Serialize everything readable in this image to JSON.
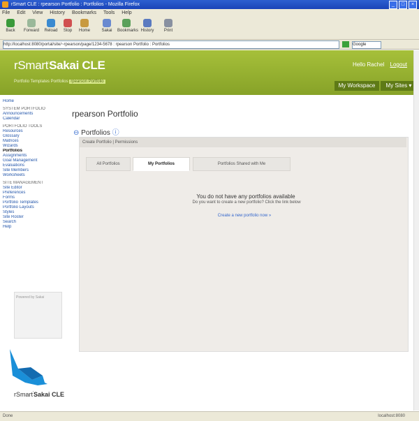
{
  "browser": {
    "title": "rSmart CLE : rpearson Portfolio : Portfolios - Mozilla Firefox",
    "menu": [
      "File",
      "Edit",
      "View",
      "History",
      "Bookmarks",
      "Tools",
      "Help"
    ],
    "toolbar": [
      "Back",
      "Forward",
      "Reload",
      "Stop",
      "Home",
      "Sakai",
      "Bookmarks",
      "History",
      "Print"
    ],
    "address": "http://localhost:8080/portal/site/~rpearson/page/1234-5678 : rpearson Portfolio : Portfolios",
    "search_placeholder": "Google",
    "status_left": "Done",
    "status_right": "localhost:8080"
  },
  "header": {
    "brand_prefix": "rSmart",
    "brand_main": "Sakai CLE",
    "greeting": "Hello Rachel",
    "logout": "Logout",
    "tabs_text": "Portfolio Templates Portfolios",
    "current_tab": "rpearson Portfolio",
    "my_workspace": "My Workspace",
    "my_sites": "My Sites ▾"
  },
  "leftnav": {
    "items": [
      {
        "label": "Home",
        "section": false,
        "current": false
      },
      {
        "label": "SYSTEM PORTFOLIO",
        "section": true,
        "current": false
      },
      {
        "label": "Announcements",
        "section": false,
        "current": false
      },
      {
        "label": "Calendar",
        "section": false,
        "current": false
      },
      {
        "label": "PORTFOLIO TOOLS",
        "section": true,
        "current": false
      },
      {
        "label": "Resources",
        "section": false,
        "current": false
      },
      {
        "label": "Glossary",
        "section": false,
        "current": false
      },
      {
        "label": "Matrices",
        "section": false,
        "current": false
      },
      {
        "label": "Wizards",
        "section": false,
        "current": false
      },
      {
        "label": "Portfolios",
        "section": false,
        "current": true
      },
      {
        "label": "Assignments",
        "section": false,
        "current": false
      },
      {
        "label": "Goal Management",
        "section": false,
        "current": false
      },
      {
        "label": "Evaluations",
        "section": false,
        "current": false
      },
      {
        "label": "Site Members",
        "section": false,
        "current": false
      },
      {
        "label": "Worksheets",
        "section": false,
        "current": false
      },
      {
        "label": "SITE MANAGEMENT",
        "section": true,
        "current": false
      },
      {
        "label": "Site Editor",
        "section": false,
        "current": false
      },
      {
        "label": "Preferences",
        "section": false,
        "current": false
      },
      {
        "label": "Forms",
        "section": false,
        "current": false
      },
      {
        "label": "Portfolio Templates",
        "section": false,
        "current": false
      },
      {
        "label": "Portfolio Layouts",
        "section": false,
        "current": false
      },
      {
        "label": "Styles",
        "section": false,
        "current": false
      },
      {
        "label": "Site Roster",
        "section": false,
        "current": false
      },
      {
        "label": "Search",
        "section": false,
        "current": false
      },
      {
        "label": "Help",
        "section": false,
        "current": false
      }
    ],
    "box_text": "Powered by Sakai"
  },
  "main": {
    "site_title": "rpearson Portfolio",
    "tool_title": "Portfolios",
    "breadcrumb": "Create Portfolio | Permissions",
    "tabs": [
      "All Portfolios",
      "My Portfolios",
      "Portfolios Shared with Me"
    ],
    "empty_title": "You do not have any portfolios available",
    "empty_sub": "Do you want to create a new portfolio? Click the link below",
    "create_link": "Create a new portfolio now »"
  },
  "footer": {
    "brand_prefix": "rSmart",
    "brand_main": "Sakai CLE"
  },
  "colors": {
    "header_green": "#97b232",
    "button_dark_green": "#5e7a16",
    "link_blue": "#3366cc"
  }
}
